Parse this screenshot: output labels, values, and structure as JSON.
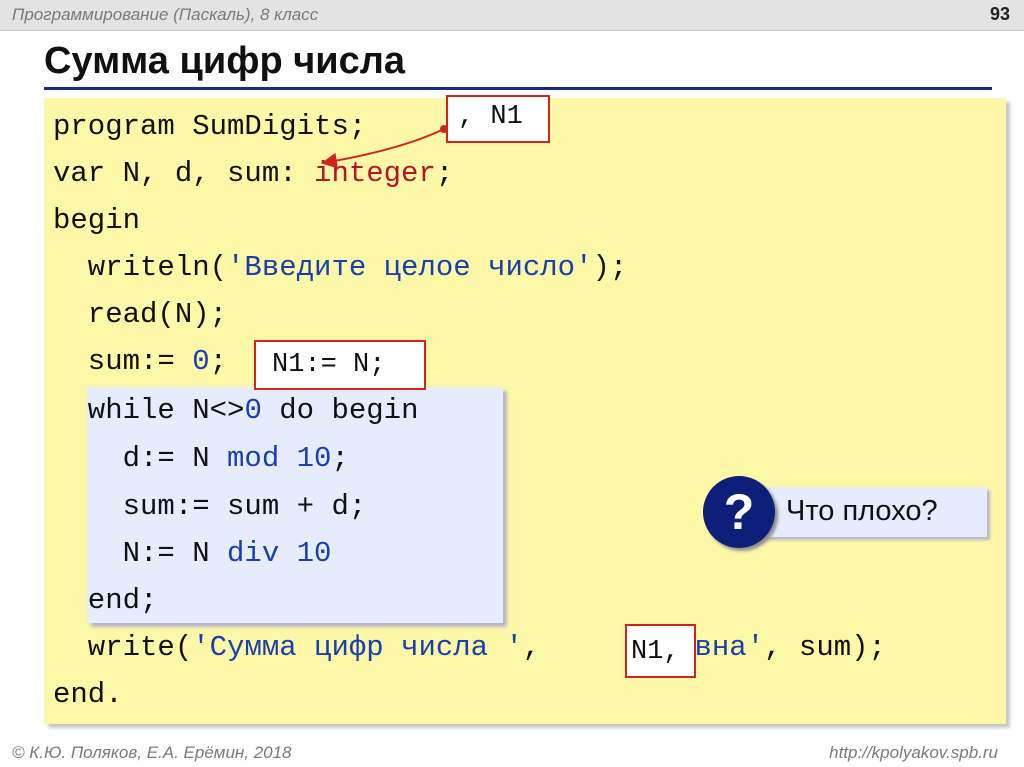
{
  "header": {
    "course": "Программирование (Паскаль), 8 класс",
    "page_number": "93"
  },
  "title": "Сумма цифр числа",
  "code": {
    "l1": {
      "a": "program SumDigits;"
    },
    "l2": {
      "a": "var N, d, sum: ",
      "type": "integer",
      "b": ";"
    },
    "l3": {
      "a": "begin"
    },
    "l4": {
      "a": "  writeln(",
      "str": "'Введите целое число'",
      "b": ");"
    },
    "l5": {
      "a": "  read(N);"
    },
    "l6": {
      "a": "  sum:= ",
      "num": "0",
      "b": ";"
    },
    "l7": {
      "a": "  while N<>",
      "num": "0",
      "b": " do begin"
    },
    "l8": {
      "a": "    d:= N ",
      "kw": "mod",
      "sp": " ",
      "num": "10",
      "b": ";"
    },
    "l9": {
      "a": "    sum:= sum + d;"
    },
    "l10": {
      "a": "    N:= N ",
      "kw": "div",
      "sp": " ",
      "num": "10"
    },
    "l11": {
      "a": "  end;"
    },
    "l12": {
      "a": "  write(",
      "str1": "'Сумма цифр числа '",
      "c1": ",",
      "str2": "'равна'",
      "c2": ", sum);"
    },
    "l13": {
      "a": "end."
    }
  },
  "callouts": {
    "decl": ", N1",
    "assign": "N1:= N;",
    "output": "N1,"
  },
  "question": {
    "badge": "?",
    "text": "Что плохо?"
  },
  "footer": {
    "authors": "© К.Ю. Поляков, Е.А. Ерёмин, 2018",
    "url": "http://kpolyakov.spb.ru"
  },
  "colors": {
    "code_background": "#fdf8a8",
    "loop_background": "#e6ecfb",
    "string_color": "#1a3fae",
    "type_color": "#b3162a",
    "callout_border": "#d0251f",
    "badge_color": "#0d1f78",
    "title_rule": "#1a2a8a"
  }
}
